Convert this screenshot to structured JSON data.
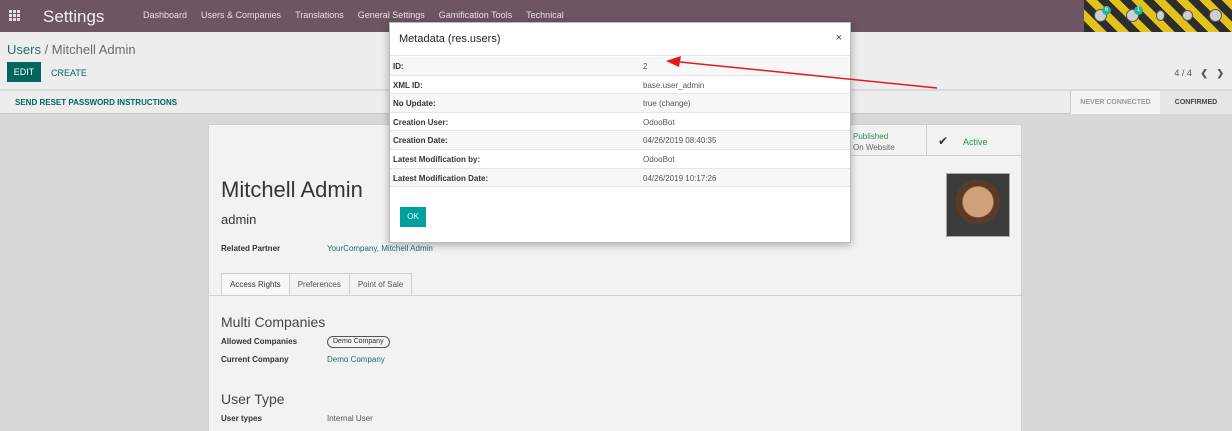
{
  "navbar": {
    "app_title": "Settings",
    "menu": [
      "Dashboard",
      "Users & Companies",
      "Translations",
      "General Settings",
      "Gamification Tools",
      "Technical"
    ],
    "icons": [
      "apps-grid-icon",
      "activity-icon",
      "chat-icon",
      "bug-icon",
      "tools-icon",
      "user-avatar-icon"
    ],
    "badges": [
      "6",
      "1"
    ],
    "colors": {
      "navbar": "#6e5563",
      "primary": "#00665e",
      "accent": "#00a09d",
      "arrow": "#e31a1c"
    }
  },
  "control": {
    "breadcrumb_parent": "Users",
    "breadcrumb_sep": " / ",
    "breadcrumb_current": "Mitchell Admin",
    "edit_label": "EDIT",
    "create_label": "CREATE",
    "pager": "4 / 4"
  },
  "statusbar": {
    "reset_label": "SEND RESET PASSWORD INSTRUCTIONS",
    "stage_never": "NEVER CONNECTED",
    "stage_confirmed": "CONFIRMED"
  },
  "form": {
    "published_line1": "Published",
    "published_line2": "On Website",
    "active_label": "Active",
    "name": "Mitchell Admin",
    "login": "admin",
    "related_partner_label": "Related Partner",
    "related_partner_value": "YourCompany, Mitchell Admin",
    "tabs": [
      "Access Rights",
      "Preferences",
      "Point of Sale"
    ],
    "multi_companies_title": "Multi Companies",
    "allowed_companies_label": "Allowed Companies",
    "allowed_companies_value": "Demo Company",
    "current_company_label": "Current Company",
    "current_company_value": "Demo Company",
    "user_type_title": "User Type",
    "user_types_label": "User types",
    "user_types_value": "Internal User"
  },
  "modal": {
    "title": "Metadata (res.users)",
    "close": "×",
    "rows": [
      {
        "key": "ID:",
        "value": "2"
      },
      {
        "key": "XML ID:",
        "value": "base.user_admin"
      },
      {
        "key": "No Update:",
        "value": "true (change)"
      },
      {
        "key": "Creation User:",
        "value": "OdooBot"
      },
      {
        "key": "Creation Date:",
        "value": "04/26/2019 08:40:35"
      },
      {
        "key": "Latest Modification by:",
        "value": "OdooBot"
      },
      {
        "key": "Latest Modification Date:",
        "value": "04/26/2019 10:17:26"
      }
    ],
    "ok_label": "OK"
  }
}
